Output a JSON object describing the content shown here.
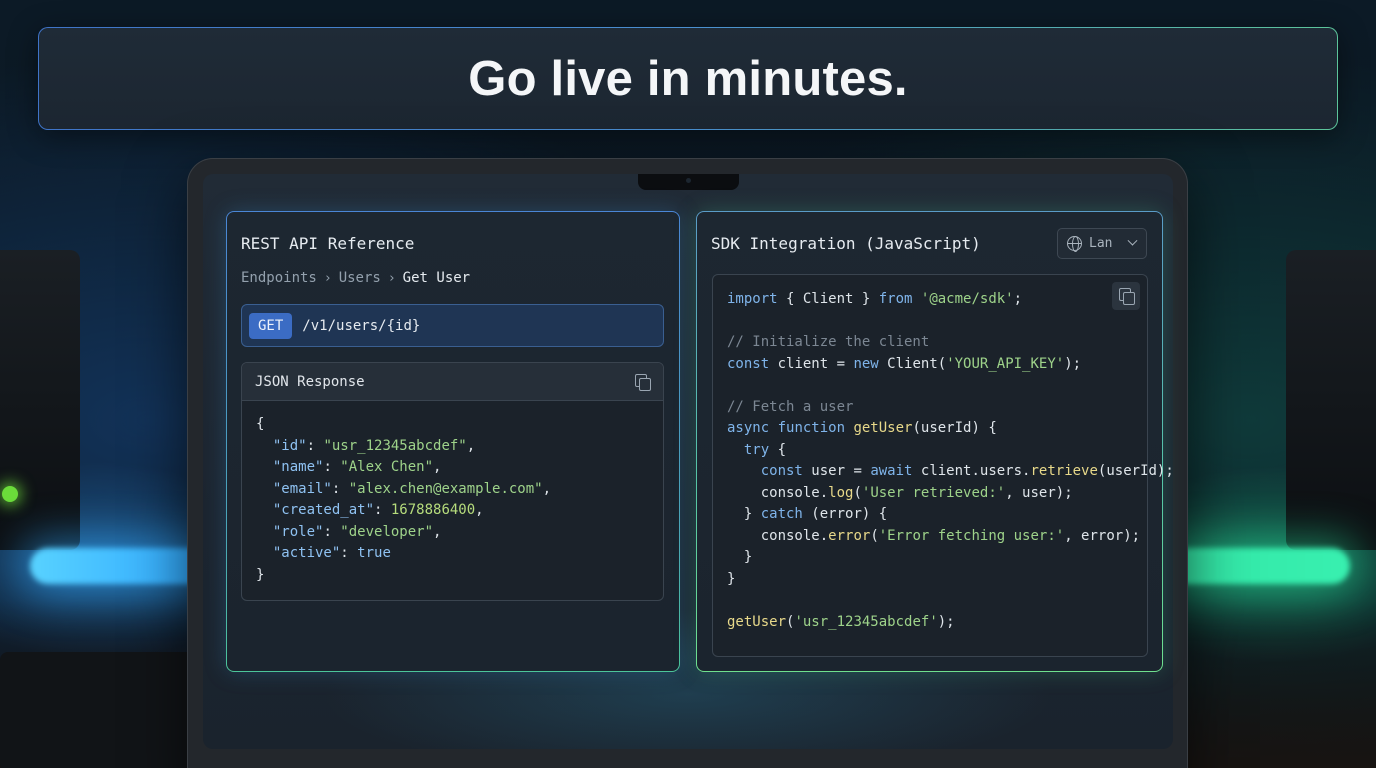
{
  "banner": {
    "headline": "Go live in minutes."
  },
  "api_panel": {
    "title": "REST API Reference",
    "breadcrumb": [
      "Endpoints",
      "Users",
      "Get User"
    ],
    "endpoint": {
      "method": "GET",
      "path": "/v1/users/{id}"
    },
    "json_response": {
      "title": "JSON Response",
      "fields": [
        {
          "key": "\"id\"",
          "value": "\"usr_12345abcdef\"",
          "type": "string"
        },
        {
          "key": "\"name\"",
          "value": "\"Alex Chen\"",
          "type": "string"
        },
        {
          "key": "\"email\"",
          "value": "\"alex.chen@example.com\"",
          "type": "string"
        },
        {
          "key": "\"created_at\"",
          "value": "1678886400",
          "type": "number"
        },
        {
          "key": "\"role\"",
          "value": "\"developer\"",
          "type": "string"
        },
        {
          "key": "\"active\"",
          "value": "true",
          "type": "bool"
        }
      ]
    }
  },
  "sdk_panel": {
    "title": "SDK Integration (JavaScript)",
    "language_selector": "Lan",
    "code": {
      "import_kw": "import",
      "import_mid": " { Client } ",
      "from_kw": "from",
      "import_src": "'@acme/sdk'",
      "comment_init": "// Initialize the client",
      "const_kw": "const",
      "client_decl": " client = ",
      "new_kw": "new",
      "client_ctor": " Client(",
      "api_key": "'YOUR_API_KEY'",
      "ctor_close": ");",
      "comment_fetch": "// Fetch a user",
      "async_kw": "async",
      "function_kw": " function ",
      "fn_name": "getUser",
      "fn_params": "(userId) {",
      "try_kw": "try",
      "try_open": " {",
      "user_decl": " user = ",
      "await_kw": "await",
      "retrieve_pre": " client.users.",
      "retrieve_fn": "retrieve",
      "retrieve_args": "(userId);",
      "console_log_pre": "console.",
      "log_fn": "log",
      "log_msg": "'User retrieved:'",
      "log_args": ", user);",
      "catch_close": "} ",
      "catch_kw": "catch",
      "catch_args": " (error) {",
      "error_fn": "error",
      "error_msg": "'Error fetching user:'",
      "error_args": ", error);",
      "close_inner": "}",
      "close_outer": "}",
      "call_fn": "getUser",
      "call_arg": "'usr_12345abcdef'",
      "call_close": ");",
      "open_paren": "(",
      "semi": ";"
    }
  },
  "colors": {
    "accent_blue": "#3b6cc4",
    "string_green": "#9ed38a",
    "key_blue": "#8fc2f2",
    "function_yellow": "#e8d98a",
    "comment_gray": "#7c8793"
  },
  "icons": [
    "copy-icon",
    "globe-icon",
    "chevron-down-icon",
    "chevron-right-icon"
  ]
}
